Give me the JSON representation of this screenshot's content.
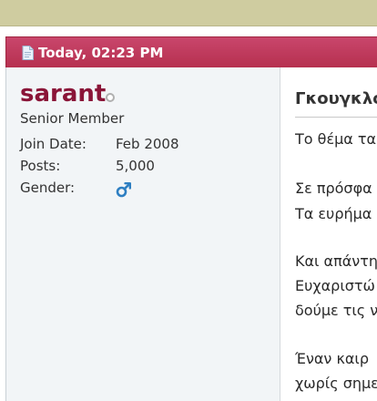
{
  "post": {
    "date": "Today, 02:23 PM",
    "title": "Γκουγκλο"
  },
  "user": {
    "name": "sarant",
    "title": "Senior Member",
    "join_date_label": "Join Date:",
    "join_date": "Feb 2008",
    "posts_label": "Posts:",
    "posts": "5,000",
    "gender_label": "Gender:",
    "gender_icon": "male-symbol-icon"
  },
  "content": {
    "lines": [
      "Το θέμα τα",
      "Σε πρόσφα",
      "Τα ευρήμα",
      "Και απάντη",
      "Ευχαριστώ",
      "δούμε τις ν",
      "Έναν καιρ",
      "χωρίς σημε"
    ]
  },
  "colors": {
    "header": "#b6304f",
    "username": "#8a1538",
    "gender_icon": "#2e7fc2"
  }
}
